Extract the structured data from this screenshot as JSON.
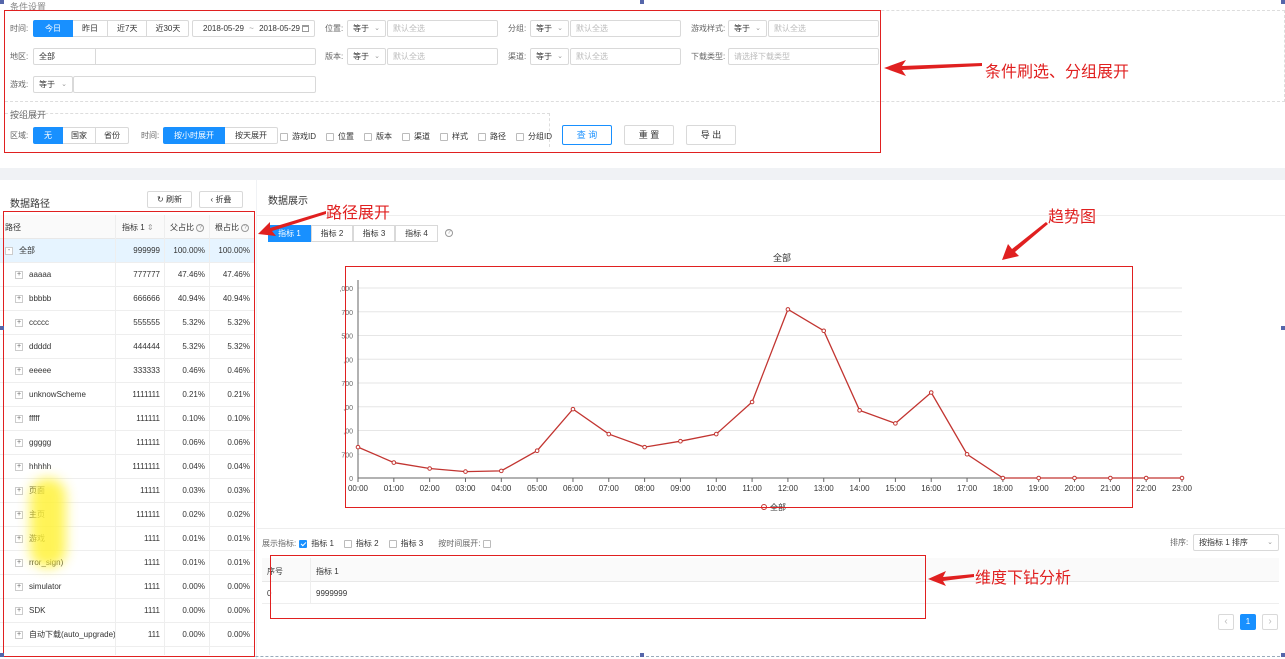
{
  "filters": {
    "section_title": "条件设置",
    "time_label": "时间:",
    "time_buttons": [
      "今日",
      "昨日",
      "近7天",
      "近30天"
    ],
    "date_start": "2018-05-29",
    "date_sep": "~",
    "date_end": "2018-05-29",
    "position_label": "位置:",
    "group_label": "分组:",
    "game_style_label": "游戏样式:",
    "region_label": "地区:",
    "version_label": "版本:",
    "channel_label": "渠道:",
    "download_type_label": "下载类型:",
    "game_label": "游戏:",
    "op_equal": "等于",
    "region_value": "全部",
    "default_all_placeholder": "默认全选",
    "download_type_placeholder": "请选择下载类型",
    "calendar_icon": "calendar-icon"
  },
  "grouping": {
    "title": "按组展开",
    "area_label": "区域:",
    "area_buttons": [
      "无",
      "国家",
      "省份"
    ],
    "time_label": "时间:",
    "time_buttons": [
      "按小时展开",
      "按天展开"
    ],
    "checks": [
      "游戏ID",
      "位置",
      "版本",
      "渠道",
      "样式",
      "路径",
      "分组ID"
    ]
  },
  "actions": {
    "query": "查 询",
    "reset": "重 置",
    "export": "导 出"
  },
  "path_panel": {
    "title": "数据路径",
    "refresh": "刷新",
    "collapse": "折叠",
    "col_path": "路径",
    "col_metric": "指标 1",
    "col_parent": "父占比",
    "col_root": "根占比",
    "rows": [
      {
        "name": "全部",
        "v": "999999",
        "p": "100.00%",
        "r": "100.00%",
        "sign": "-"
      },
      {
        "name": "aaaaa",
        "v": "777777",
        "p": "47.46%",
        "r": "47.46%",
        "sign": "+"
      },
      {
        "name": "bbbbb",
        "v": "666666",
        "p": "40.94%",
        "r": "40.94%",
        "sign": "+"
      },
      {
        "name": "ccccc",
        "v": "555555",
        "p": "5.32%",
        "r": "5.32%",
        "sign": "+"
      },
      {
        "name": "ddddd",
        "v": "444444",
        "p": "5.32%",
        "r": "5.32%",
        "sign": "+"
      },
      {
        "name": "eeeee",
        "v": "333333",
        "p": "0.46%",
        "r": "0.46%",
        "sign": "+"
      },
      {
        "name": "unknowScheme",
        "v": "1111111",
        "p": "0.21%",
        "r": "0.21%",
        "sign": "+"
      },
      {
        "name": "fffff",
        "v": "111111",
        "p": "0.10%",
        "r": "0.10%",
        "sign": "+"
      },
      {
        "name": "ggggg",
        "v": "111111",
        "p": "0.06%",
        "r": "0.06%",
        "sign": "+"
      },
      {
        "name": "hhhhh",
        "v": "1111111",
        "p": "0.04%",
        "r": "0.04%",
        "sign": "+"
      },
      {
        "name": "页面",
        "v": "11111",
        "p": "0.03%",
        "r": "0.03%",
        "sign": "+"
      },
      {
        "name": "主页",
        "v": "111111",
        "p": "0.02%",
        "r": "0.02%",
        "sign": "+"
      },
      {
        "name": "游戏",
        "v": "1111",
        "p": "0.01%",
        "r": "0.01%",
        "sign": "+"
      },
      {
        "name": "rror_sign)",
        "v": "1111",
        "p": "0.01%",
        "r": "0.01%",
        "sign": "+"
      },
      {
        "name": "simulator",
        "v": "1111",
        "p": "0.00%",
        "r": "0.00%",
        "sign": "+"
      },
      {
        "name": "SDK",
        "v": "1111",
        "p": "0.00%",
        "r": "0.00%",
        "sign": "+"
      },
      {
        "name": "自动下载(auto_upgrade)",
        "v": "111",
        "p": "0.00%",
        "r": "0.00%",
        "sign": "+"
      }
    ]
  },
  "data_panel": {
    "title": "数据展示",
    "tabs": [
      "指标 1",
      "指标 2",
      "指标 3",
      "指标 4"
    ],
    "show_metrics_label": "展示指标:",
    "metric_checks": [
      "指标 1",
      "指标 2",
      "指标 3"
    ],
    "by_time_label": "按时间展开:",
    "sort_label": "排序:",
    "sort_value": "按指标 1 排序",
    "table_col_index": "序号",
    "table_col_metric": "指标 1",
    "table_row_index": "0",
    "table_row_value": "9999999",
    "page": "1",
    "page_prev": "‹",
    "page_next": "›"
  },
  "chart_data": {
    "type": "line",
    "title": "全部",
    "x": [
      "00:00",
      "01:00",
      "02:00",
      "03:00",
      "04:00",
      "05:00",
      "06:00",
      "07:00",
      "08:00",
      "09:00",
      "10:00",
      "11:00",
      "12:00",
      "13:00",
      "14:00",
      "15:00",
      "16:00",
      "17:00",
      "18:00",
      "19:00",
      "20:00",
      "21:00",
      "22:00",
      "23:00"
    ],
    "series": [
      {
        "name": "全部",
        "values": [
          130,
          65,
          40,
          27,
          30,
          115,
          290,
          185,
          130,
          155,
          185,
          320,
          710,
          620,
          285,
          230,
          360,
          100,
          0,
          0,
          0,
          0,
          0,
          0
        ],
        "color": "#c23531"
      }
    ],
    "ylim": [
      0,
      800
    ],
    "ytick_labels": [
      "700",
      ",00",
      ",00",
      "700",
      ",00",
      "500",
      "700",
      ",000"
    ],
    "grid": true,
    "legend": "bottom"
  },
  "annotations": {
    "filter": "条件刷选、分组展开",
    "path": "路径展开",
    "trend": "趋势图",
    "drill": "维度下钻分析"
  }
}
